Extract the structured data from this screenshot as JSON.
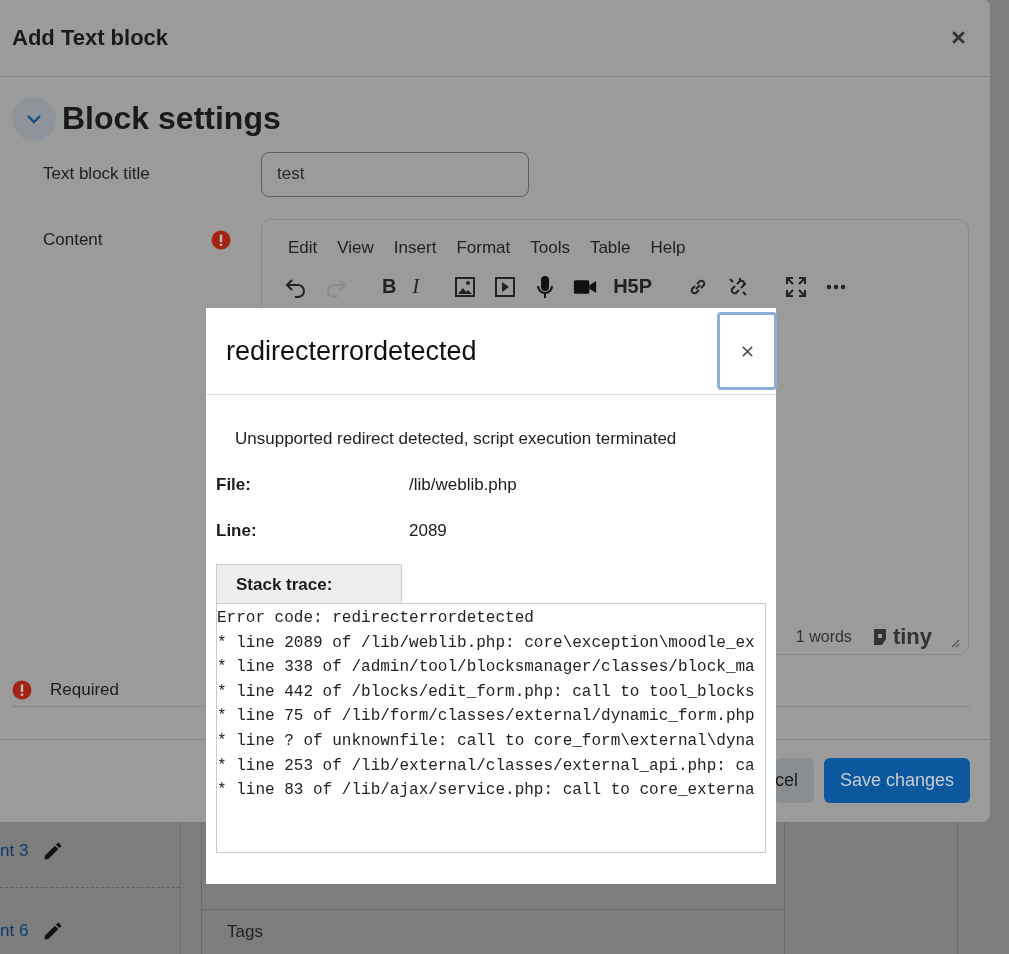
{
  "background": {
    "items": [
      {
        "text": "nt 3"
      },
      {
        "text": "nt 6"
      }
    ],
    "tags_label": "Tags"
  },
  "modal": {
    "title": "Add Text block",
    "section": {
      "title": "Block settings",
      "expanded": true
    },
    "fields": [
      {
        "label": "Text block title",
        "value": "test"
      }
    ],
    "content": {
      "label": "Content",
      "required": true,
      "menu": [
        "Edit",
        "View",
        "Insert",
        "Format",
        "Tools",
        "Table",
        "Help"
      ],
      "toolbar": [
        {
          "kind": "undo",
          "disabled": false
        },
        {
          "kind": "redo",
          "disabled": true
        },
        {
          "kind": "text",
          "label": "B",
          "disabled": false
        },
        {
          "kind": "italic",
          "label": "I",
          "disabled": false
        },
        {
          "kind": "image",
          "disabled": false
        },
        {
          "kind": "media",
          "disabled": false
        },
        {
          "kind": "mic",
          "disabled": false
        },
        {
          "kind": "video",
          "disabled": false
        },
        {
          "kind": "text",
          "label": "H5P",
          "disabled": false
        },
        {
          "kind": "link",
          "disabled": false
        },
        {
          "kind": "unlink",
          "disabled": false
        },
        {
          "kind": "fullscreen",
          "disabled": false
        },
        {
          "kind": "more",
          "disabled": false
        }
      ],
      "word_count": "1 words",
      "brand": "tiny"
    },
    "required_note": "Required",
    "buttons": [
      {
        "label": "cel",
        "kind": "secondary"
      },
      {
        "label": "Save changes",
        "kind": "primary"
      }
    ]
  },
  "error_dialog": {
    "title": "redirecterrordetected",
    "message": "Unsupported redirect detected, script execution terminated",
    "details": [
      {
        "label": "File:",
        "value": "/lib/weblib.php"
      },
      {
        "label": "Line:",
        "value": "2089"
      }
    ],
    "stack_tab": "Stack trace:",
    "stack_lines": [
      "Error code: redirecterrordetected",
      "* line 2089 of /lib/weblib.php: core\\exception\\moodle_ex",
      "* line 338 of /admin/tool/blocksmanager/classes/block_ma",
      "* line 442 of /blocks/edit_form.php: call to tool_blocks",
      "* line 75 of /lib/form/classes/external/dynamic_form.php",
      "* line ? of unknownfile: call to core_form\\external\\dyna",
      "* line 253 of /lib/external/classes/external_api.php: ca",
      "* line 83 of /lib/ajax/service.php: call to core_externa"
    ]
  }
}
